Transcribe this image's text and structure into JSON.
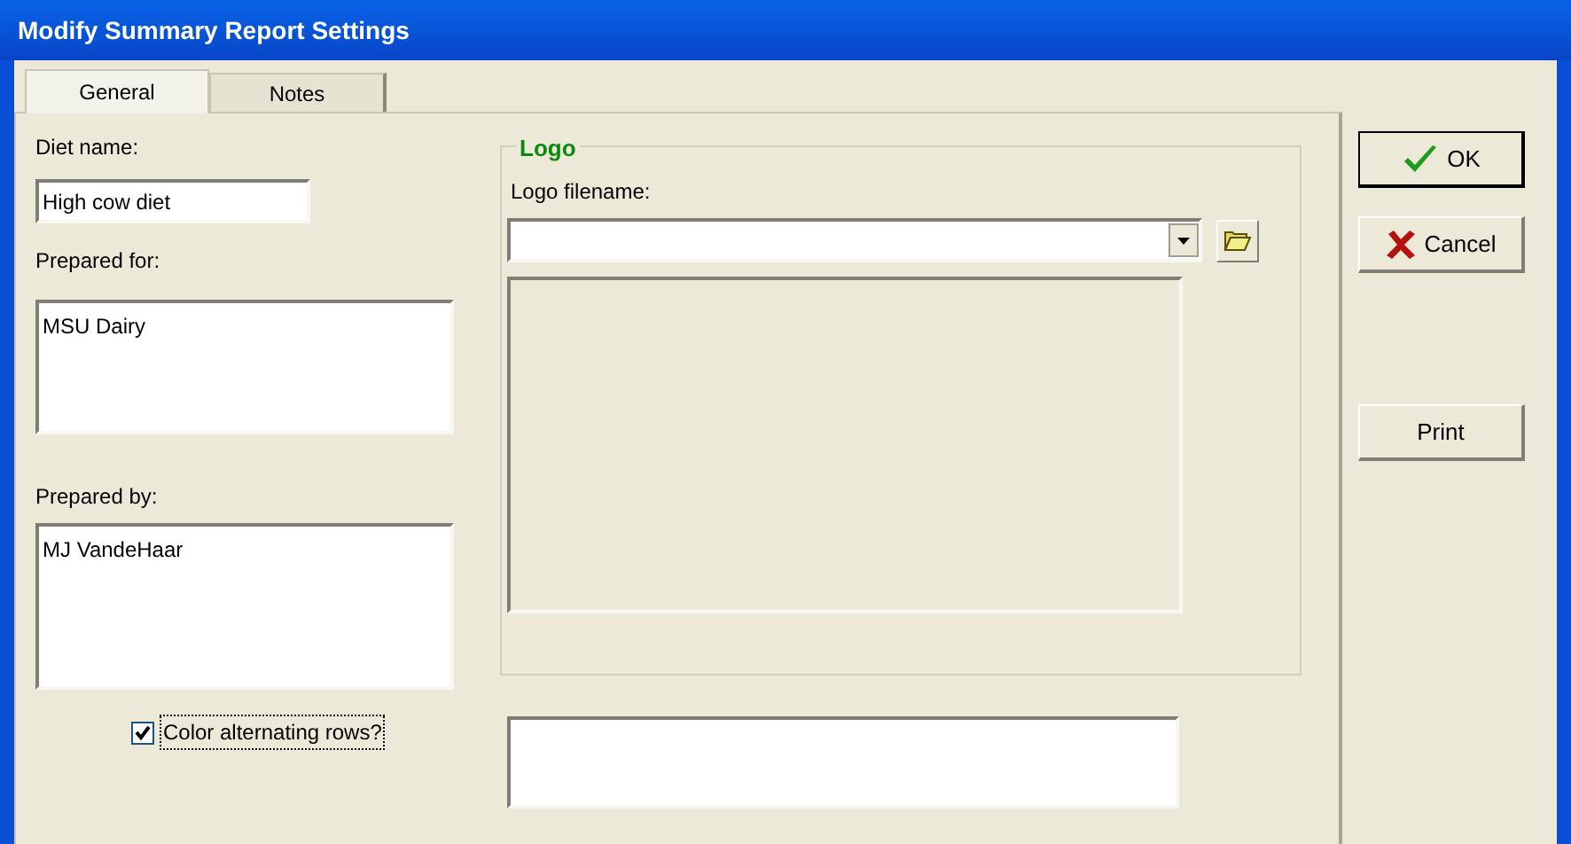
{
  "window": {
    "title": "Modify Summary Report Settings"
  },
  "tabs": [
    {
      "label": "General",
      "selected": true
    },
    {
      "label": "Notes",
      "selected": false
    }
  ],
  "diet_name": {
    "label": "Diet name:",
    "value": "High cow diet"
  },
  "prepared_for": {
    "label": "Prepared for:",
    "value": "MSU Dairy"
  },
  "prepared_by": {
    "label": "Prepared by:",
    "value": "MJ VandeHaar"
  },
  "color_alternating_rows": {
    "label": "Color alternating rows?",
    "checked": true
  },
  "logo": {
    "title": "Logo",
    "filename_label": "Logo filename:"
  },
  "buttons": [
    {
      "label": "OK",
      "kind": "ok"
    },
    {
      "label": "Cancel",
      "kind": "cancel"
    },
    {
      "label": "Print",
      "kind": "plain"
    }
  ]
}
